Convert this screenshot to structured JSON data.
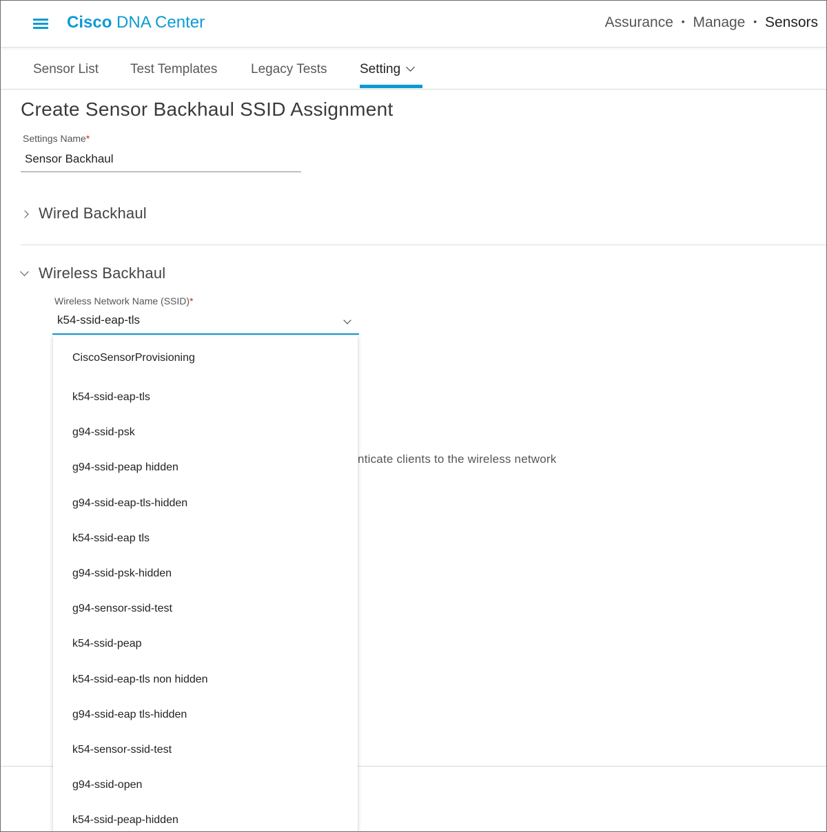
{
  "header": {
    "brand_bold": "Cisco",
    "brand_rest": "DNA Center",
    "breadcrumbs": [
      "Assurance",
      "Manage",
      "Sensors"
    ],
    "separator": "•"
  },
  "tabs": [
    {
      "label": "Sensor List"
    },
    {
      "label": "Test Templates"
    },
    {
      "label": "Legacy Tests"
    },
    {
      "label": "Setting"
    }
  ],
  "page": {
    "title": "Create Sensor Backhaul SSID Assignment",
    "settings_name_label": "Settings Name",
    "required_mark": "*",
    "settings_name_value": "Sensor Backhaul"
  },
  "sections": {
    "wired": "Wired Backhaul",
    "wireless": "Wireless Backhaul"
  },
  "ssid_field": {
    "label": "Wireless Network Name (SSID)",
    "selected": "k54-ssid-eap-tls",
    "options": [
      "CiscoSensorProvisioning",
      "k54-ssid-eap-tls",
      "g94-ssid-psk",
      "g94-ssid-peap hidden",
      "g94-ssid-eap-tls-hidden",
      "k54-ssid-eap tls",
      "g94-ssid-psk-hidden",
      "g94-sensor-ssid-test",
      "k54-ssid-peap",
      "k54-ssid-eap-tls non hidden",
      "g94-ssid-eap tls-hidden",
      "k54-sensor-ssid-test",
      "g94-ssid-open",
      "k54-ssid-peap-hidden"
    ]
  },
  "background_text": "rver to authenticate clients to the wireless network",
  "icons": {
    "menu": "hamburger-menu-icon",
    "section_collapsed": "chevron-right-icon",
    "section_expanded": "chevron-down-icon",
    "select": "chevron-down-icon"
  },
  "colors": {
    "accent": "#0d9bd3",
    "required": "#d0271d"
  }
}
